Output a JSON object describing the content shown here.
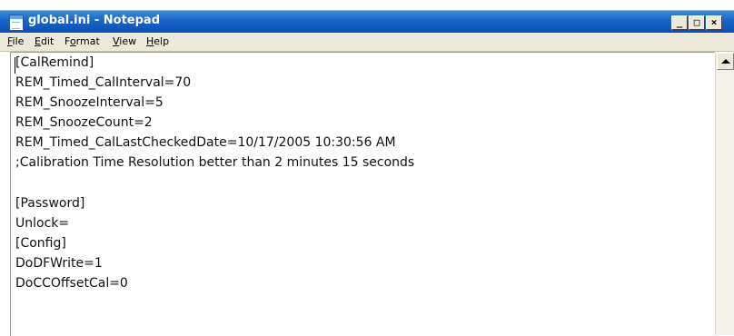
{
  "window": {
    "title": "global.ini - Notepad",
    "buttons": {
      "minimize": "_",
      "maximize": "□",
      "close": "×"
    }
  },
  "menu": {
    "items": [
      {
        "pre": "",
        "u": "F",
        "post": "ile"
      },
      {
        "pre": "",
        "u": "E",
        "post": "dit"
      },
      {
        "pre": "F",
        "u": "o",
        "post": "rmat"
      },
      {
        "pre": "",
        "u": "V",
        "post": "iew"
      },
      {
        "pre": "",
        "u": "H",
        "post": "elp"
      }
    ]
  },
  "editor": {
    "lines": [
      "[CalRemind]",
      "REM_Timed_CalInterval=70",
      "REM_SnoozeInterval=5",
      "REM_SnoozeCount=2",
      "REM_Timed_CalLastCheckedDate=10/17/2005 10:30:56 AM",
      ";Calibration Time Resolution better than 2 minutes 15 seconds",
      "",
      "[Password]",
      "Unlock=",
      "[Config]",
      "DoDFWrite=1",
      "DoCCOffsetCal=0"
    ]
  },
  "icons": {
    "app": "notepad-icon",
    "scroll_up": "arrow-up-icon"
  }
}
